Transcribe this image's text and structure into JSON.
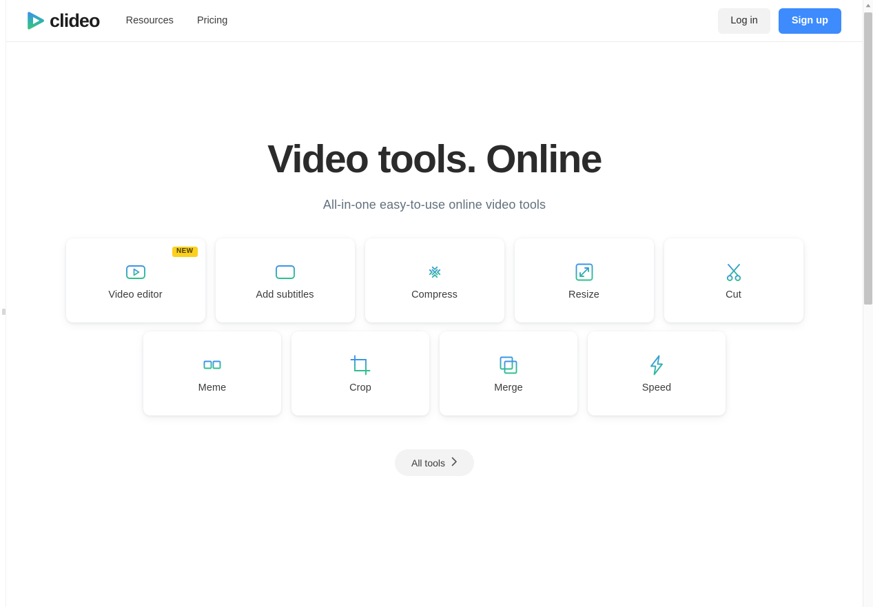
{
  "header": {
    "logo": {
      "icon": "clideo-play-logo-icon",
      "text": "clideo"
    },
    "nav": [
      {
        "label": "Resources"
      },
      {
        "label": "Pricing"
      }
    ],
    "actions": {
      "login_label": "Log in",
      "signup_label": "Sign up"
    }
  },
  "hero": {
    "title": "Video tools. Online",
    "subtitle": "All-in-one easy-to-use online video tools"
  },
  "tools": {
    "row1": [
      {
        "label": "Video editor",
        "icon": "video-editor-icon",
        "badge": "NEW"
      },
      {
        "label": "Add subtitles",
        "icon": "add-subtitles-icon",
        "badge": ""
      },
      {
        "label": "Compress",
        "icon": "compress-icon",
        "badge": ""
      },
      {
        "label": "Resize",
        "icon": "resize-icon",
        "badge": ""
      },
      {
        "label": "Cut",
        "icon": "cut-scissors-icon",
        "badge": ""
      }
    ],
    "row2": [
      {
        "label": "Meme",
        "icon": "meme-icon",
        "badge": ""
      },
      {
        "label": "Crop",
        "icon": "crop-icon",
        "badge": ""
      },
      {
        "label": "Merge",
        "icon": "merge-icon",
        "badge": ""
      },
      {
        "label": "Speed",
        "icon": "speed-lightning-icon",
        "badge": ""
      }
    ]
  },
  "all_tools": {
    "label": "All tools",
    "icon": "chevron-right-icon"
  },
  "scrollbar": {
    "up_arrow_icon": "scroll-up-arrow-icon"
  },
  "colors": {
    "accent_blue": "#3d8bfd",
    "badge_yellow": "#fbd01e",
    "icon_gradient_start": "#3f8ff0",
    "icon_gradient_end": "#2fbf8f",
    "title_dark": "#2b2b2b",
    "subtitle_gray": "#62707e"
  }
}
